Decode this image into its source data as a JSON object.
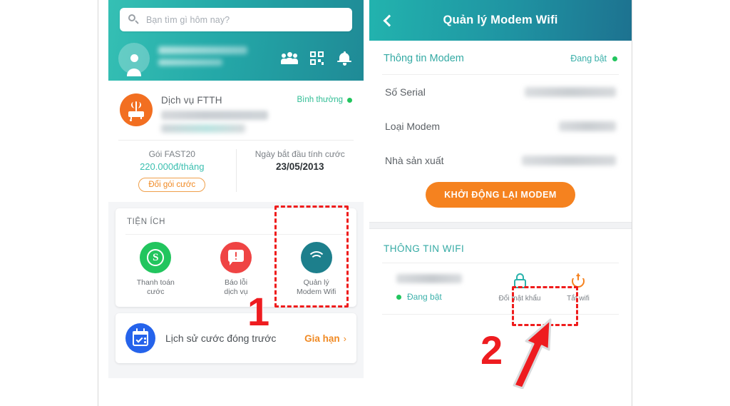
{
  "left_panel": {
    "search": {
      "placeholder": "Bạn tìm gì hôm nay?",
      "icon": "search-icon"
    },
    "header_icons": [
      {
        "name": "group-icon",
        "label": ""
      },
      {
        "name": "qr-code-icon",
        "label": ""
      },
      {
        "name": "bell-icon",
        "label": ""
      }
    ],
    "service": {
      "title": "Dịch vụ FTTH",
      "status": "Bình thường",
      "status_color": "#2ebd94",
      "icon": "modem-icon",
      "plan_label": "Gói FAST20",
      "plan_price": "220.000đ/tháng",
      "change_plan_button": "Đổi gói cước",
      "billing_label": "Ngày bắt đầu tính cước",
      "billing_date": "23/05/2013"
    },
    "utilities": {
      "header": "TIỆN ÍCH",
      "items": [
        {
          "label": "Thanh toán\ncước",
          "line1": "Thanh toán",
          "line2": "cước",
          "icon": "dollar-icon",
          "color": "#22c55e"
        },
        {
          "label": "Báo lỗi\ndịch vụ",
          "line1": "Báo lỗi",
          "line2": "dịch vụ",
          "icon": "report-error-icon",
          "color": "#ef4444"
        },
        {
          "label": "Quản lý\nModem Wifi",
          "line1": "Quản lý",
          "line2": "Modem Wifi",
          "icon": "wifi-icon",
          "color": "#1d7f8c"
        }
      ]
    },
    "history": {
      "label": "Lịch sử cước đóng trước",
      "action": "Gia hạn",
      "chevron": "›",
      "icon": "calendar-check-icon",
      "icon_color": "#2563eb"
    }
  },
  "right_panel": {
    "header": {
      "title": "Quản lý Modem Wifi",
      "back_icon": "back-chevron-icon"
    },
    "modem_section": {
      "title": "Thông tin Modem",
      "status": "Đang bật",
      "status_color": "#3bb0aa",
      "rows": [
        {
          "label": "Số Serial",
          "value": ""
        },
        {
          "label": "Loại Modem",
          "value": ""
        },
        {
          "label": "Nhà sản xuất",
          "value": ""
        }
      ],
      "restart_button": "KHỞI ĐỘNG LẠI MODEM",
      "restart_button_color": "#f5821f"
    },
    "wifi_section": {
      "title": "THÔNG TIN WIFI",
      "ssid": "",
      "state": "Đang bật",
      "actions": [
        {
          "label": "Đổi mật khẩu",
          "icon": "lock-icon",
          "color": "#2bb3ac"
        },
        {
          "label": "Tắt wifi",
          "icon": "power-icon",
          "color": "#f5821f"
        }
      ]
    }
  },
  "annotations": {
    "step1": "1",
    "step2": "2",
    "highlight_color": "#ef1c1c"
  }
}
